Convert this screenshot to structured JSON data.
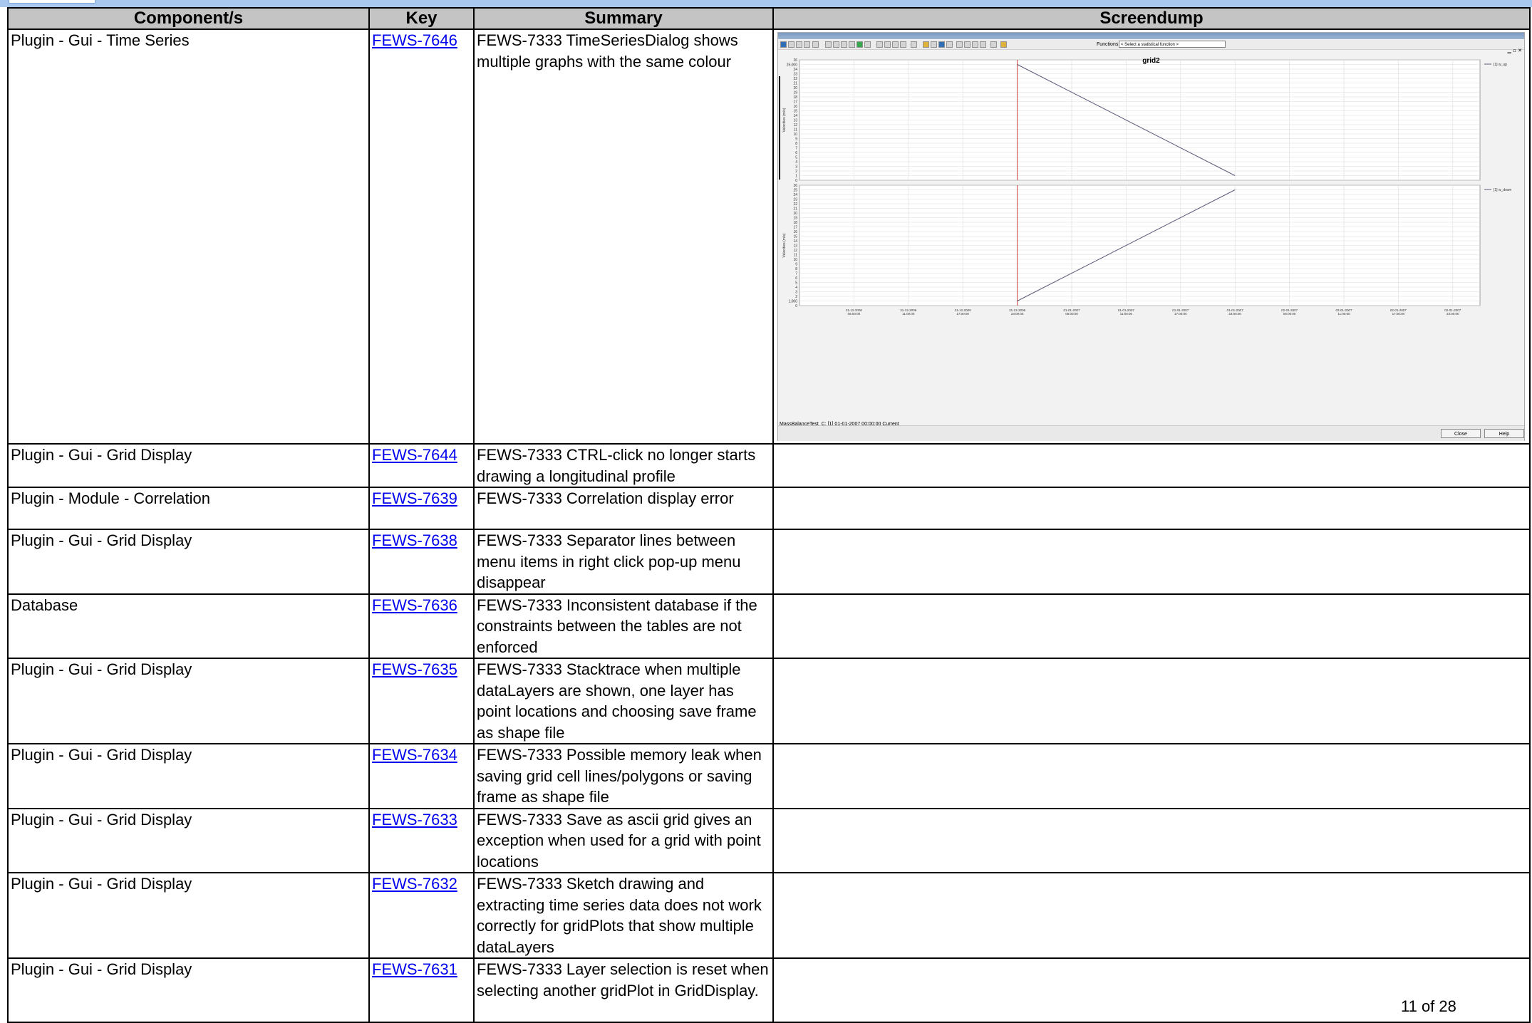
{
  "headers": {
    "component": "Component/s",
    "key": "Key",
    "summary": "Summary",
    "screendump": "Screendump"
  },
  "rows": [
    {
      "component": "Plugin - Gui - Time Series",
      "key": "FEWS-7646",
      "summary": "FEWS-7333 TimeSeriesDialog shows multiple graphs with the same colour"
    },
    {
      "component": "Plugin - Gui - Grid Display",
      "key": "FEWS-7644",
      "summary": "FEWS-7333 CTRL-click no longer starts drawing a longitudinal profile"
    },
    {
      "component": "Plugin - Module - Correlation",
      "key": "FEWS-7639",
      "summary": "FEWS-7333 Correlation display error"
    },
    {
      "component": "Plugin - Gui - Grid Display",
      "key": "FEWS-7638",
      "summary": "FEWS-7333 Separator lines between menu items in right click pop-up menu disappear"
    },
    {
      "component": "Database",
      "key": "FEWS-7636",
      "summary": "FEWS-7333 Inconsistent database if the constraints between the tables are not enforced"
    },
    {
      "component": "Plugin - Gui - Grid Display",
      "key": "FEWS-7635",
      "summary": "FEWS-7333 Stacktrace when multiple dataLayers are shown, one layer has point locations and choosing save frame as shape file"
    },
    {
      "component": "Plugin - Gui - Grid Display",
      "key": "FEWS-7634",
      "summary": "FEWS-7333 Possible memory leak when saving grid cell lines/polygons or saving frame as shape file"
    },
    {
      "component": "Plugin - Gui - Grid Display",
      "key": "FEWS-7633",
      "summary": "FEWS-7333 Save as ascii grid gives an exception when used for a grid with point locations"
    },
    {
      "component": "Plugin - Gui - Grid Display",
      "key": "FEWS-7632",
      "summary": "FEWS-7333 Sketch drawing and extracting time series data does not work correctly for gridPlots that show multiple dataLayers"
    },
    {
      "component": "Plugin - Gui - Grid Display",
      "key": "FEWS-7631",
      "summary": "FEWS-7333 Layer selection is reset when selecting another gridPlot in GridDisplay."
    }
  ],
  "page_number": "11 of 28",
  "screenshot": {
    "functions_label": "Functions",
    "function_select": "< Select a statistical function >",
    "close_button": "Close",
    "help_button": "Help",
    "status_text": "MassBalanceTest_C: [1] 01-01-2007 00:00:00 Current",
    "colors": {
      "line": "#5a5a7a",
      "marker": "#d04040",
      "grid": "#dcdcdc"
    }
  },
  "chart_data": [
    {
      "type": "line",
      "title": "grid2",
      "ylabel": "Velocities (m/s)",
      "xlabel": "",
      "x_ticks": [
        "31-12-2006 05:00:00",
        "31-12-2006 11:00:00",
        "31-12-2006 17:00:00",
        "31-12-2006 23:00:00",
        "01-01-2007 05:00:00",
        "01-01-2007 11:00:00",
        "01-01-2007 17:00:00",
        "01-01-2007 23:00:00",
        "02-01-2007 05:00:00",
        "02-01-2007 11:00:00",
        "02-01-2007 17:00:00",
        "02-01-2007 23:00:00"
      ],
      "y_ticks": [
        "0",
        "1",
        "2",
        "3",
        "4",
        "5",
        "6",
        "7",
        "8",
        "9",
        "10",
        "11",
        "12",
        "13",
        "14",
        "15",
        "16",
        "17",
        "18",
        "19",
        "20",
        "21",
        "22",
        "23",
        "24",
        "25,000",
        "26"
      ],
      "ylim": [
        0,
        26
      ],
      "series": [
        {
          "name": "[1] w_up",
          "x": [
            "31-12-2006 23:00:00",
            "01-01-2007 23:00:00"
          ],
          "y": [
            25,
            1
          ]
        }
      ],
      "marker_time": "31-12-2006 23:00:00",
      "grid": true,
      "legend": "right"
    },
    {
      "type": "line",
      "title": "",
      "ylabel": "Velocities (m/s)",
      "xlabel": "",
      "x_ticks": [
        "31-12-2006 05:00:00",
        "31-12-2006 11:00:00",
        "31-12-2006 17:00:00",
        "31-12-2006 23:00:00",
        "01-01-2007 05:00:00",
        "01-01-2007 11:00:00",
        "01-01-2007 17:00:00",
        "01-01-2007 23:00:00",
        "02-01-2007 05:00:00",
        "02-01-2007 11:00:00",
        "02-01-2007 17:00:00",
        "02-01-2007 23:00:00"
      ],
      "y_ticks": [
        "0",
        "1,000",
        "2",
        "3",
        "4",
        "5",
        "6",
        "7",
        "8",
        "9",
        "10",
        "11",
        "12",
        "13",
        "14",
        "15",
        "16",
        "17",
        "18",
        "19",
        "20",
        "21",
        "22",
        "23",
        "24",
        "25",
        "26"
      ],
      "ylim": [
        0,
        26
      ],
      "series": [
        {
          "name": "[1] w_down",
          "x": [
            "31-12-2006 23:00:00",
            "01-01-2007 23:00:00"
          ],
          "y": [
            1,
            25
          ]
        }
      ],
      "marker_time": "31-12-2006 23:00:00",
      "grid": true,
      "legend": "right"
    }
  ]
}
